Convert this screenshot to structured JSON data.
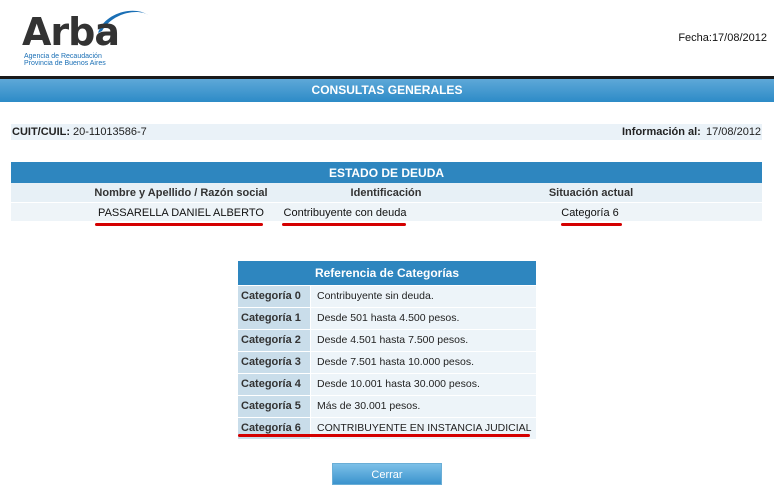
{
  "header": {
    "logo_word": "Arba",
    "logo_tagline_1": "Agencia de Recaudación",
    "logo_tagline_2": "Provincia de Buenos Aires",
    "date_label": "Fecha:17/08/2012"
  },
  "title": "CONSULTAS GENERALES",
  "cuit": {
    "label": "CUIT/CUIL:",
    "value": "20-11013586-7",
    "info_label": "Información al:",
    "info_value": "17/08/2012"
  },
  "deuda": {
    "title": "ESTADO DE DEUDA",
    "columns": [
      "Nombre y Apellido / Razón social",
      "Identificación",
      "Situación actual"
    ],
    "row": [
      "PASSARELLA DANIEL ALBERTO",
      "Contribuyente con deuda",
      "Categoría 6"
    ]
  },
  "referencia": {
    "title": "Referencia de Categorías",
    "rows": [
      {
        "cat": "Categoría 0",
        "desc": "Contribuyente sin deuda."
      },
      {
        "cat": "Categoría 1",
        "desc": "Desde 501 hasta 4.500 pesos."
      },
      {
        "cat": "Categoría 2",
        "desc": "Desde 4.501 hasta 7.500 pesos."
      },
      {
        "cat": "Categoría 3",
        "desc": "Desde 7.501 hasta 10.000 pesos."
      },
      {
        "cat": "Categoría 4",
        "desc": "Desde 10.001 hasta 30.000 pesos."
      },
      {
        "cat": "Categoría 5",
        "desc": "Más de 30.001 pesos."
      },
      {
        "cat": "Categoría 6",
        "desc": "CONTRIBUYENTE EN INSTANCIA JUDICIAL"
      }
    ]
  },
  "buttons": {
    "close": "Cerrar"
  },
  "colors": {
    "accent": "#2e86bf",
    "highlight": "#d40000"
  }
}
